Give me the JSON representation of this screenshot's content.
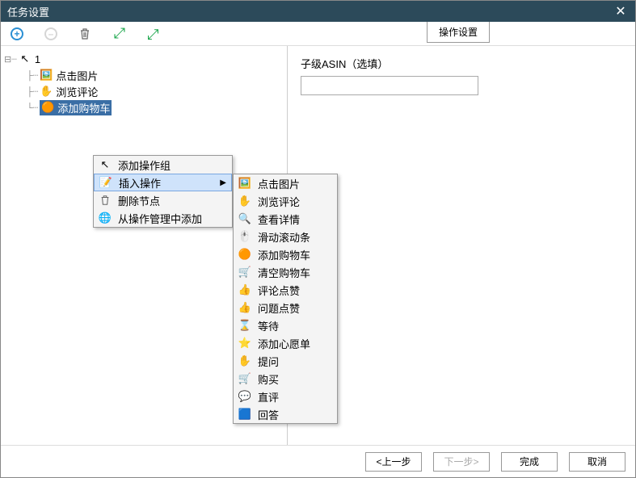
{
  "window": {
    "title": "任务设置"
  },
  "toolbar": {
    "tab_label": "操作设置"
  },
  "tree": {
    "root": "1",
    "items": [
      "点击图片",
      "浏览评论",
      "添加购物车"
    ]
  },
  "right": {
    "field_label": "子级ASIN（选填）",
    "field_value": ""
  },
  "context_menu_1": {
    "add_group": "添加操作组",
    "insert_action": "插入操作",
    "delete_node": "删除节点",
    "add_from_mgr": "从操作管理中添加"
  },
  "context_menu_2": {
    "items": [
      "点击图片",
      "浏览评论",
      "查看详情",
      "滑动滚动条",
      "添加购物车",
      "清空购物车",
      "评论点赞",
      "问题点赞",
      "等待",
      "添加心愿单",
      "提问",
      "购买",
      "直评",
      "回答"
    ]
  },
  "footer": {
    "prev": "<上一步",
    "next": "下一步>",
    "finish": "完成",
    "cancel": "取消"
  }
}
